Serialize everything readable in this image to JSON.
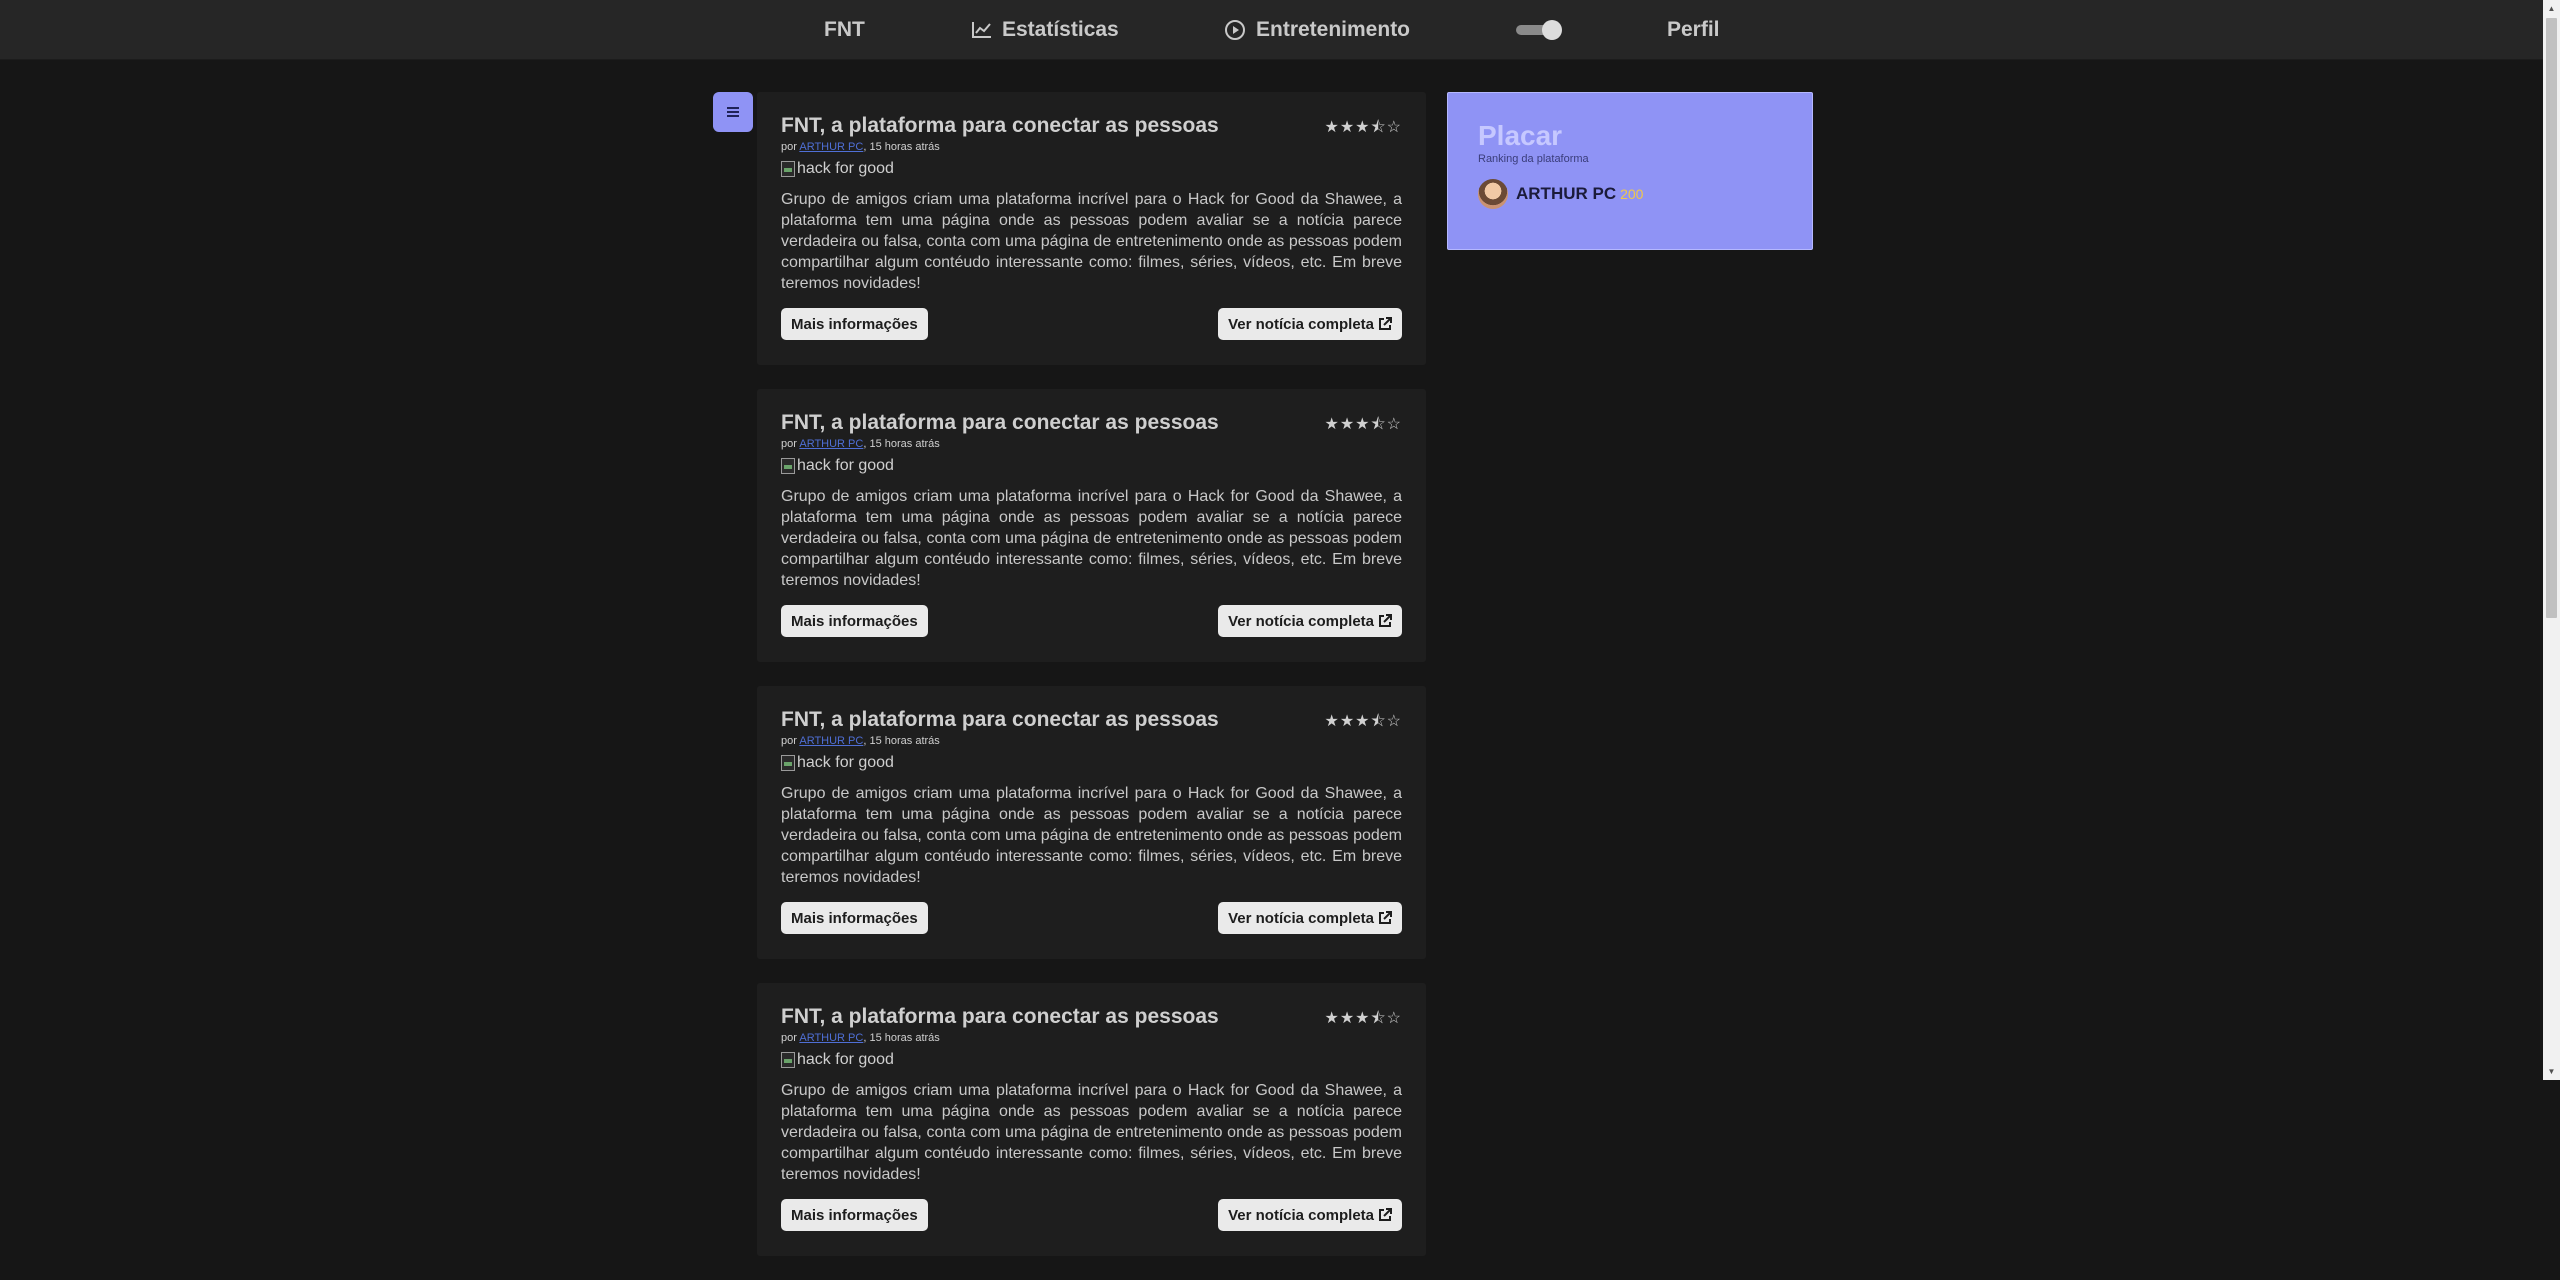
{
  "nav": {
    "brand": "FNT",
    "stats_label": "Estatísticas",
    "entertainment_label": "Entretenimento",
    "profile_label": "Perfil",
    "theme_toggle_on": true
  },
  "feed": {
    "posts": [
      {
        "title": "FNT, a plataforma para conectar as pessoas",
        "stars": "★★★⯪☆",
        "meta_prefix": "por",
        "author": "ARTHUR PC",
        "time": ", 15 horas atrás",
        "image_alt": "hack for good",
        "body": "Grupo de amigos criam uma plataforma incrível para o Hack for Good da Shawee, a plataforma tem uma página onde as pessoas podem avaliar se a notícia parece verdadeira ou falsa, conta com uma página de entretenimento onde as pessoas podem compartilhar algum contéudo interessante como: filmes, séries, vídeos, etc. Em breve teremos novidades!",
        "more_label": "Mais informações",
        "full_label": "Ver notícia completa"
      },
      {
        "title": "FNT, a plataforma para conectar as pessoas",
        "stars": "★★★⯪☆",
        "meta_prefix": "por",
        "author": "ARTHUR PC",
        "time": ", 15 horas atrás",
        "image_alt": "hack for good",
        "body": "Grupo de amigos criam uma plataforma incrível para o Hack for Good da Shawee, a plataforma tem uma página onde as pessoas podem avaliar se a notícia parece verdadeira ou falsa, conta com uma página de entretenimento onde as pessoas podem compartilhar algum contéudo interessante como: filmes, séries, vídeos, etc. Em breve teremos novidades!",
        "more_label": "Mais informações",
        "full_label": "Ver notícia completa"
      },
      {
        "title": "FNT, a plataforma para conectar as pessoas",
        "stars": "★★★⯪☆",
        "meta_prefix": "por",
        "author": "ARTHUR PC",
        "time": ", 15 horas atrás",
        "image_alt": "hack for good",
        "body": "Grupo de amigos criam uma plataforma incrível para o Hack for Good da Shawee, a plataforma tem uma página onde as pessoas podem avaliar se a notícia parece verdadeira ou falsa, conta com uma página de entretenimento onde as pessoas podem compartilhar algum contéudo interessante como: filmes, séries, vídeos, etc. Em breve teremos novidades!",
        "more_label": "Mais informações",
        "full_label": "Ver notícia completa"
      },
      {
        "title": "FNT, a plataforma para conectar as pessoas",
        "stars": "★★★⯪☆",
        "meta_prefix": "por",
        "author": "ARTHUR PC",
        "time": ", 15 horas atrás",
        "image_alt": "hack for good",
        "body": "Grupo de amigos criam uma plataforma incrível para o Hack for Good da Shawee, a plataforma tem uma página onde as pessoas podem avaliar se a notícia parece verdadeira ou falsa, conta com uma página de entretenimento onde as pessoas podem compartilhar algum contéudo interessante como: filmes, séries, vídeos, etc. Em breve teremos novidades!",
        "more_label": "Mais informações",
        "full_label": "Ver notícia completa"
      }
    ]
  },
  "scoreboard": {
    "title": "Placar",
    "subtitle": "Ranking da plataforma",
    "entries": [
      {
        "name": "ARTHUR PC",
        "score": "200"
      }
    ]
  },
  "colors": {
    "accent": "#8f93f5",
    "background": "#161616",
    "card": "#1e1e1e",
    "score": "#f0c84a"
  },
  "icons": {
    "stats": "chart-line-icon",
    "entertainment": "play-circle-icon",
    "menu": "hamburger-menu-icon",
    "external": "external-link-icon"
  }
}
